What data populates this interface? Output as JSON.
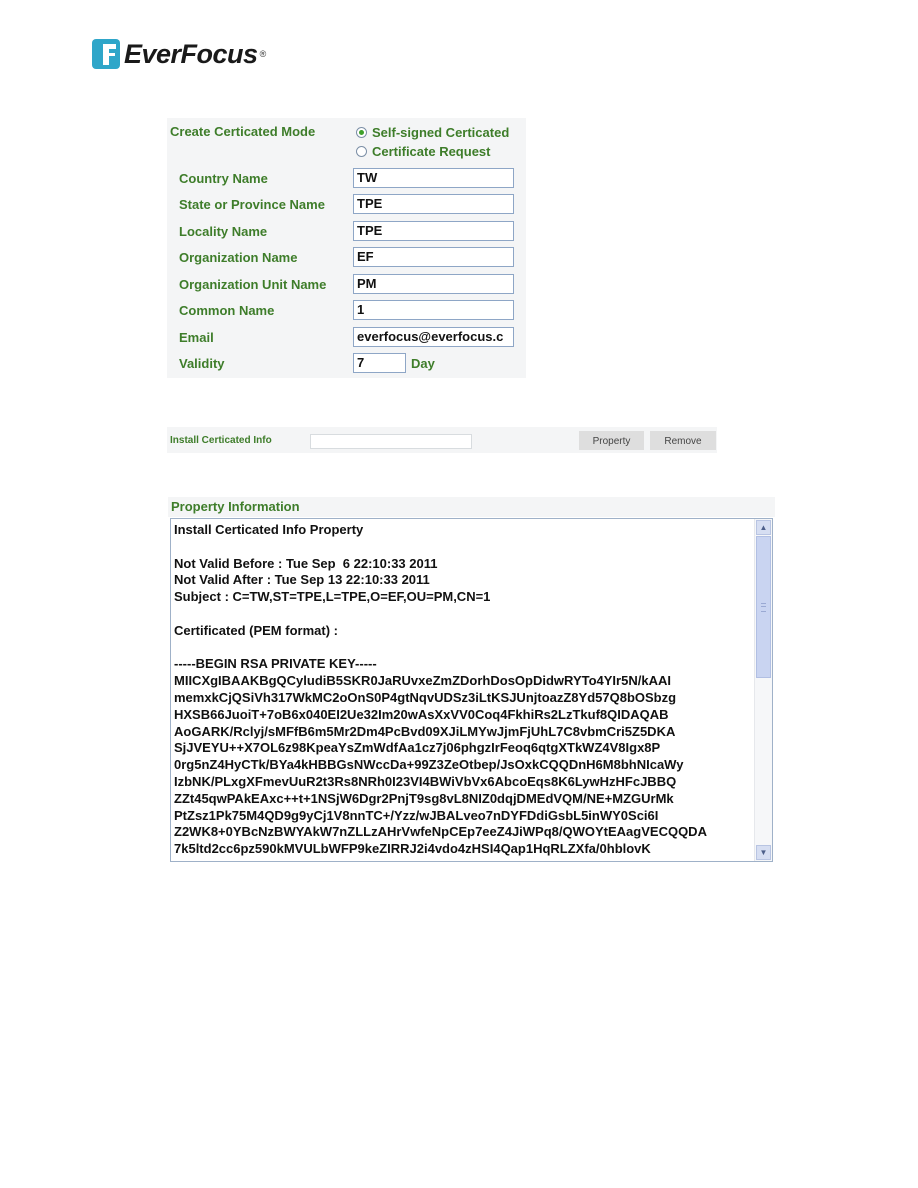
{
  "brand": {
    "name": "EverFocus",
    "registered_mark": "®"
  },
  "certificate_form": {
    "mode_label": "Create Certicated Mode",
    "mode_options": [
      {
        "label": "Self-signed Certicated",
        "selected": true
      },
      {
        "label": "Certificate Request",
        "selected": false
      }
    ],
    "fields": [
      {
        "label": "Country Name",
        "value": "TW"
      },
      {
        "label": "State or Province Name",
        "value": "TPE"
      },
      {
        "label": "Locality Name",
        "value": "TPE"
      },
      {
        "label": "Organization Name",
        "value": "EF"
      },
      {
        "label": "Organization Unit Name",
        "value": "PM"
      },
      {
        "label": "Common Name",
        "value": "1"
      },
      {
        "label": "Email",
        "value": "everfocus@everfocus.c"
      }
    ],
    "validity": {
      "label": "Validity",
      "value": "7",
      "unit": "Day"
    }
  },
  "install_bar": {
    "label": "Install Certicated Info",
    "input_value": "",
    "property_button": "Property",
    "remove_button": "Remove"
  },
  "property_info": {
    "title": "Property Information",
    "content": "Install Certicated Info Property\n\nNot Valid Before : Tue Sep  6 22:10:33 2011\nNot Valid After : Tue Sep 13 22:10:33 2011\nSubject : C=TW,ST=TPE,L=TPE,O=EF,OU=PM,CN=1\n\nCertificated (PEM format) :\n\n-----BEGIN RSA PRIVATE KEY-----\nMIICXgIBAAKBgQCyludiB5SKR0JaRUvxeZmZDorhDosOpDidwRYTo4YIr5N/kAAI\nmemxkCjQSiVh317WkMC2oOnS0P4gtNqvUDSz3iLtKSJUnjtoazZ8Yd57Q8bOSbzg\nHXSB66JuoiT+7oB6x040EI2Ue32Im20wAsXxVV0Coq4FkhiRs2LzTkuf8QIDAQAB\nAoGARK/Rclyj/sMFfB6m5Mr2Dm4PcBvd09XJiLMYwJjmFjUhL7C8vbmCri5Z5DKA\nSjJVEYU++X7OL6z98KpeaYsZmWdfAa1cz7j06phgzIrFeoq6qtgXTkWZ4V8Igx8P\n0rg5nZ4HyCTk/BYa4kHBBGsNWccDa+99Z3ZeOtbep/JsOxkCQQDnH6M8bhNIcaWy\nIzbNK/PLxgXFmevUuR2t3Rs8NRh0I23VI4BWiVbVx6AbcoEqs8K6LywHzHFcJBBQ\nZZt45qwPAkEAxc++t+1NSjW6Dgr2PnjT9sg8vL8NIZ0dqjDMEdVQM/NE+MZGUrMk\nPtZsz1Pk75M4QD9g9yCj1V8nnTC+/Yzz/wJBALveo7nDYFDdiGsbL5inWY0Sci6I\nZ2WK8+0YBcNzBWYAkW7nZLLzAHrVwfeNpCEp7eeZ4JiWPq8/QWOYtEAagVECQQDA\n7k5ltd2cc6pz590kMVULbWFP9keZIRRJ2i4vdo4zHSI4Qap1HqRLZXfa/0hblovK",
    "scroll_position": 0
  }
}
